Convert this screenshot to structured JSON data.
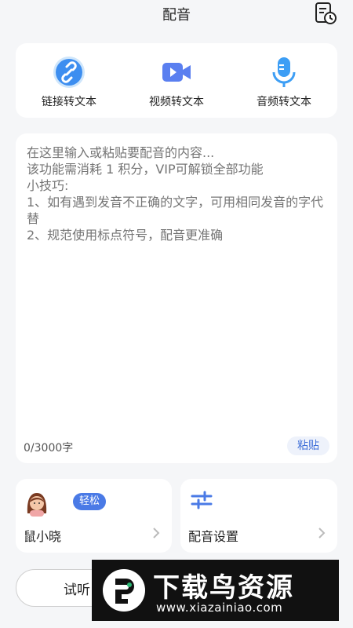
{
  "header": {
    "title": "配音",
    "history_icon": "history-document-icon"
  },
  "tools": [
    {
      "label": "链接转文本",
      "icon": "link-icon",
      "color": "#3d8ef0"
    },
    {
      "label": "视频转文本",
      "icon": "video-camera-icon",
      "color": "#5a7ff0"
    },
    {
      "label": "音频转文本",
      "icon": "microphone-icon",
      "color": "#3d9ef5"
    }
  ],
  "editor": {
    "placeholder": "在这里输入或粘贴要配音的内容...\n该功能需消耗 1 积分，VIP可解锁全部功能\n小技巧:\n1、如有遇到发音不正确的文字，可用相同发音的字代替\n2、规范使用标点符号，配音更准确",
    "count": "0/3000字",
    "paste_label": "粘贴"
  },
  "voice": {
    "badge": "轻松",
    "name": "鼠小晓",
    "avatar_icon": "female-avatar-icon"
  },
  "settings": {
    "label": "配音设置",
    "icon": "sliders-icon"
  },
  "actions": {
    "listen_label": "试听"
  },
  "watermark": {
    "title": "下载鸟资源",
    "url": "www.xiazainiao.com"
  },
  "colors": {
    "accent": "#4a7ae6",
    "background": "#f5f6f8"
  }
}
